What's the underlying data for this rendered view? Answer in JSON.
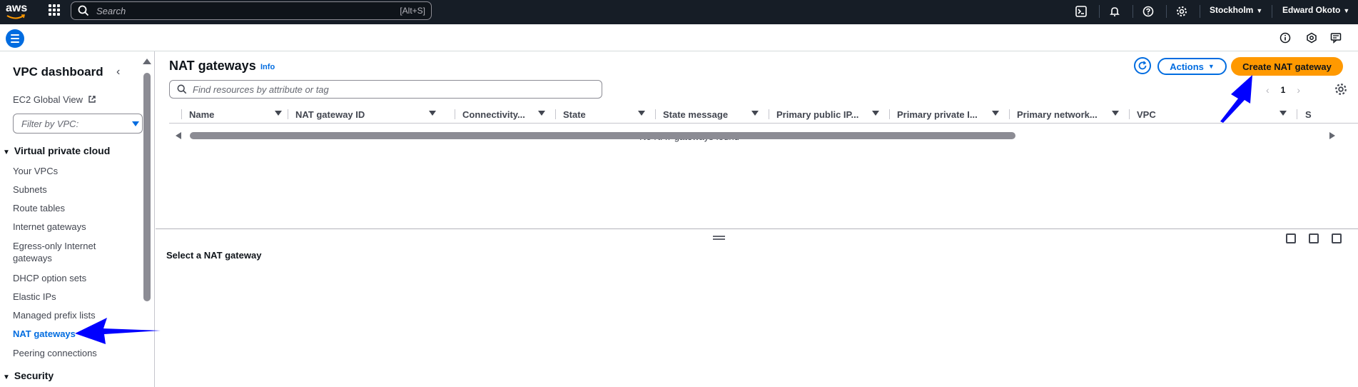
{
  "topnav": {
    "logo": "aws",
    "search_placeholder": "Search",
    "search_shortcut": "[Alt+S]",
    "region": "Stockholm",
    "user": "Edward Okoto",
    "icons": [
      "cloudshell-icon",
      "bell-icon",
      "help-icon",
      "gear-icon"
    ]
  },
  "subbar": {
    "icons": [
      "info-circle-icon",
      "hexagon-icon",
      "feedback-icon"
    ]
  },
  "sidebar": {
    "title": "VPC dashboard",
    "global_view": "EC2 Global View",
    "filter_placeholder": "Filter by VPC:",
    "sections": [
      {
        "label": "Virtual private cloud",
        "items": [
          "Your VPCs",
          "Subnets",
          "Route tables",
          "Internet gateways",
          "Egress-only Internet gateways",
          "DHCP option sets",
          "Elastic IPs",
          "Managed prefix lists",
          "NAT gateways",
          "Peering connections"
        ]
      },
      {
        "label": "Security"
      }
    ],
    "active_item": "NAT gateways"
  },
  "main": {
    "title": "NAT gateways",
    "info": "Info",
    "actions_label": "Actions",
    "create_label": "Create NAT gateway",
    "search_placeholder": "Find resources by attribute or tag",
    "page_number": "1",
    "columns": [
      "Name",
      "NAT gateway ID",
      "Connectivity...",
      "State",
      "State message",
      "Primary public IP...",
      "Primary private I...",
      "Primary network...",
      "VPC",
      "S"
    ],
    "empty_message": "No NAT gateways found",
    "detail_title": "Select a NAT gateway"
  },
  "colors": {
    "nav_bg": "#161d26",
    "accent": "#006ce0",
    "primary_button": "#ff9900",
    "annotation_arrow": "#0000ff"
  }
}
